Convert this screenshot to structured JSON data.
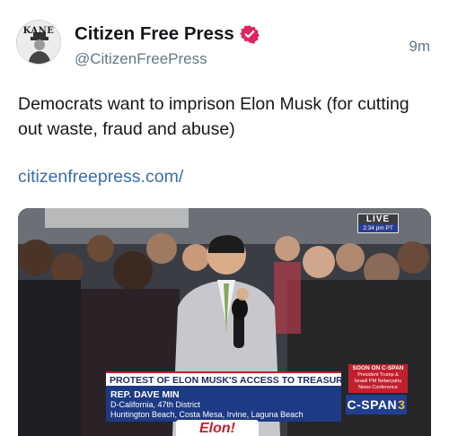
{
  "post": {
    "display_name": "Citizen Free Press",
    "handle": "@CitizenFreePress",
    "time": "9m",
    "avatar_text": "KANE",
    "verified_icon": "verified-badge-icon",
    "text": "Democrats want to imprison Elon Musk (for cutting out waste, fraud and abuse)",
    "link": "citizenfreepress.com/"
  },
  "video": {
    "live_label": "LIVE",
    "live_time": "2:34 pm PT",
    "banner": "PROTEST OF ELON MUSK'S ACCESS TO TREASURY DEPT.",
    "speaker_name": "REP. DAVE MIN",
    "speaker_district": "D-California, 47th District",
    "speaker_cities": "Huntington Beach, Costa Mesa, Irvine, Laguna Beach",
    "soon_title": "SOON ON C-SPAN",
    "soon_line1": "President Trump &",
    "soon_line2": "Israeli PM Netanyahu",
    "soon_line3": "News Conference",
    "network_logo": "C-SPAN",
    "network_number": "3",
    "sign_text": "Elon!"
  },
  "colors": {
    "name_text": "#14171a",
    "secondary_text": "#657786",
    "link": "#3b6ea8",
    "verified": "#e0245e",
    "cspan_blue": "#1f3f8f",
    "cspan_red": "#c21f2e"
  }
}
